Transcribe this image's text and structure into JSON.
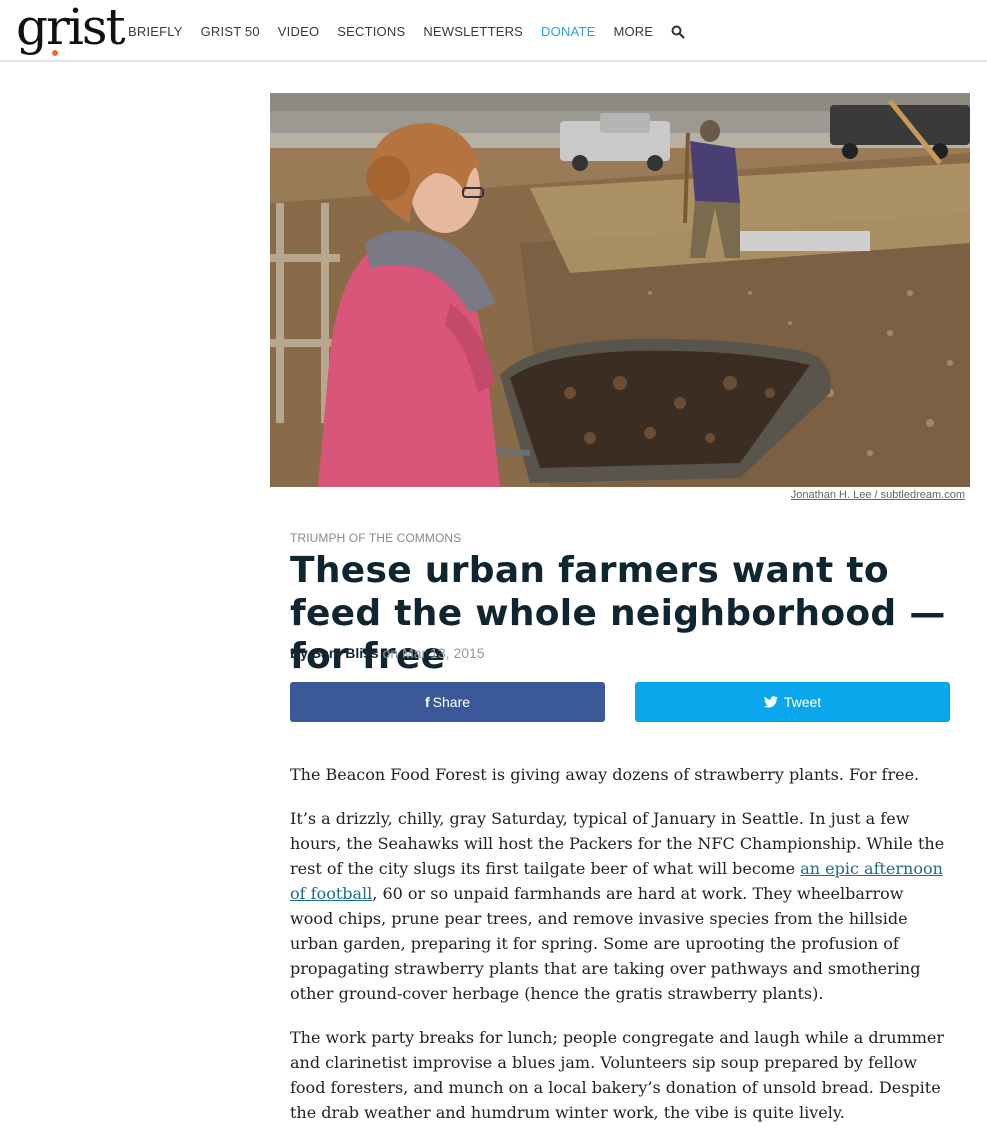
{
  "header": {
    "logo_text": "grist",
    "nav": [
      {
        "label": "BRIEFLY"
      },
      {
        "label": "GRIST 50"
      },
      {
        "label": "VIDEO"
      },
      {
        "label": "SECTIONS"
      },
      {
        "label": "NEWSLETTERS"
      },
      {
        "label": "DONATE"
      },
      {
        "label": "MORE"
      }
    ],
    "search_icon": "search-icon",
    "accent_color": "#2aa3d8",
    "logo_dot_color": "#f26b21"
  },
  "hero": {
    "photo_credit": "Jonathan H. Lee / subtledream.com"
  },
  "article": {
    "kicker": "TRIUMPH OF THE COMMONS",
    "headline": "These urban farmers want to feed the whole neighborhood — for free",
    "byline_prefix": "By ",
    "author": "Sam Bliss",
    "date_prefix": " on ",
    "date": "Mar 13, 2015",
    "share": {
      "facebook_label": "Share",
      "facebook_icon": "f",
      "facebook_color": "#3b5998",
      "twitter_label": "Tweet",
      "twitter_color": "#0aa7ec"
    },
    "paragraphs": {
      "p1": "The Beacon Food Forest is giving away dozens of strawberry plants. For free.",
      "p2_before": "It’s a drizzly, chilly, gray Saturday, typical of January in Seattle. In just a few hours, the Seahawks will host the Packers for the NFC Championship. While the rest of the city slugs its first tailgate beer of what will become ",
      "p2_link": "an epic afternoon of football",
      "p2_after": ", 60 or so unpaid farmhands are hard at work. They wheelbarrow wood chips, prune pear trees, and remove invasive species from the hillside urban garden, preparing it for spring. Some are uprooting the profusion of propagating strawberry plants that are taking over pathways and smothering other ground-cover herbage (hence the gratis strawberry plants).",
      "p3": "The work party breaks for lunch; people congregate and laugh while a drummer and clarinetist improvise a blues jam. Volunteers sip soup prepared by fellow food foresters, and munch on a local bakery’s donation of unsold bread. Despite the drab weather and humdrum winter work, the vibe is quite lively."
    }
  }
}
